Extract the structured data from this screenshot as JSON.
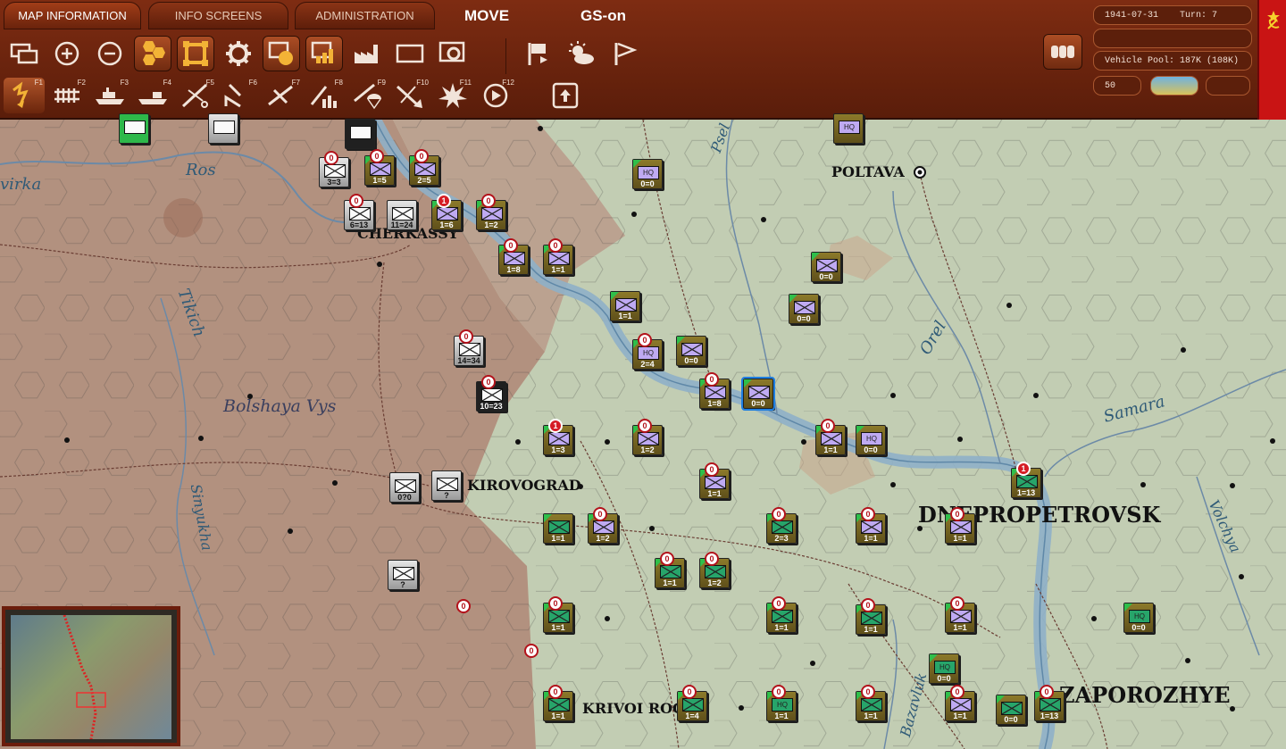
{
  "tabs": [
    {
      "label": "MAP INFORMATION",
      "active": true
    },
    {
      "label": "INFO SCREENS",
      "active": false
    },
    {
      "label": "ADMINISTRATION",
      "active": false
    }
  ],
  "mode": {
    "phase": "MOVE",
    "gs": "GS-on"
  },
  "status": {
    "date": "1941-07-31",
    "turn": "Turn: 7",
    "line2": "",
    "vehicle_pool": "Vehicle Pool: 187K (108K)",
    "zoom": "50"
  },
  "toolbar": {
    "icons": [
      "windows-icon",
      "zoom-in-icon",
      "zoom-out-icon",
      "hex-grid-icon",
      "unit-icon",
      "gear-icon",
      "counter-stack-icon",
      "supply-icon",
      "factory-icon",
      "rectangle-icon",
      "settings-window-icon",
      "flag-exit-icon",
      "weather-icon",
      "pennant-icon",
      "army-icon"
    ]
  },
  "fkeys": [
    {
      "k": "F1",
      "icon": "move-arrow-icon"
    },
    {
      "k": "F2",
      "icon": "rail-icon"
    },
    {
      "k": "F3",
      "icon": "ship-icon"
    },
    {
      "k": "F4",
      "icon": "sea-transport-icon"
    },
    {
      "k": "F5",
      "icon": "air-recon-icon"
    },
    {
      "k": "F6",
      "icon": "airlift-icon"
    },
    {
      "k": "F7",
      "icon": "air-bomb-icon"
    },
    {
      "k": "F8",
      "icon": "city-bomb-icon"
    },
    {
      "k": "F9",
      "icon": "paradrop-icon"
    },
    {
      "k": "F10",
      "icon": "air-transfer-icon"
    },
    {
      "k": "F11",
      "icon": "explosion-icon"
    },
    {
      "k": "F12",
      "icon": "next-unit-icon"
    },
    {
      "k": "",
      "icon": "upload-icon"
    }
  ],
  "cities": [
    {
      "name": "POLTAVA"
    },
    {
      "name": "CHERKASSY"
    },
    {
      "name": "KIROVOGRAD"
    },
    {
      "name": "DNEPROPETROVSK"
    },
    {
      "name": "KRIVOI ROG"
    },
    {
      "name": "ZAPOROZHYE"
    }
  ],
  "rivers": [
    {
      "name": "Ros"
    },
    {
      "name": "Tikich"
    },
    {
      "name": "Psel"
    },
    {
      "name": "Orel"
    },
    {
      "name": "Samara"
    },
    {
      "name": "Volchya"
    },
    {
      "name": "Sinyukha"
    },
    {
      "name": "Bazavluk"
    },
    {
      "name": "virka"
    }
  ],
  "terrain": [
    {
      "name": "Bolshaya Vys"
    }
  ],
  "units": [
    {
      "side": "ger",
      "icon": "w",
      "val": "3=3",
      "badge": "0"
    },
    {
      "side": "sov",
      "icon": "v",
      "val": "1=5",
      "badge": "0"
    },
    {
      "side": "sov",
      "icon": "v",
      "val": "2=5",
      "badge": "0"
    },
    {
      "side": "ger",
      "icon": "w",
      "val": "6=13",
      "badge": "0"
    },
    {
      "side": "ger",
      "icon": "w",
      "val": "11=24",
      "badge": ""
    },
    {
      "side": "sov",
      "icon": "v",
      "val": "1=6",
      "badge": "1"
    },
    {
      "side": "sov",
      "icon": "v",
      "val": "1=2",
      "badge": "0"
    },
    {
      "side": "sov",
      "icon": "v",
      "val": "1=8",
      "badge": "0"
    },
    {
      "side": "sov",
      "icon": "v",
      "val": "1=1",
      "badge": "0"
    },
    {
      "side": "sov",
      "icon": "v",
      "val": "0=0",
      "badge": "",
      "hq": "HQ"
    },
    {
      "side": "sov",
      "icon": "v",
      "val": "1=1",
      "badge": ""
    },
    {
      "side": "sov",
      "icon": "v",
      "val": "0=0",
      "badge": ""
    },
    {
      "side": "sov",
      "icon": "v",
      "val": "0=0",
      "badge": ""
    },
    {
      "side": "ger",
      "icon": "w",
      "val": "14=34",
      "badge": "0"
    },
    {
      "side": "sov",
      "icon": "v",
      "val": "2=4",
      "badge": "0",
      "hq": "HQ"
    },
    {
      "side": "sov",
      "icon": "v",
      "val": "0=0",
      "badge": ""
    },
    {
      "side": "blk",
      "icon": "w",
      "val": "10=23",
      "badge": "0"
    },
    {
      "side": "sov",
      "icon": "v",
      "val": "1=8",
      "badge": "0"
    },
    {
      "side": "sov",
      "icon": "v",
      "val": "0=0",
      "badge": ""
    },
    {
      "side": "sov",
      "icon": "v",
      "val": "1=3",
      "badge": "1"
    },
    {
      "side": "sov",
      "icon": "v",
      "val": "1=2",
      "badge": "0"
    },
    {
      "side": "sov",
      "icon": "v",
      "val": "1=1",
      "badge": "0"
    },
    {
      "side": "sov",
      "icon": "v",
      "val": "0=0",
      "badge": "",
      "hq": "HQ"
    },
    {
      "side": "sov",
      "icon": "v",
      "val": "1=1",
      "badge": "0"
    },
    {
      "side": "ger",
      "icon": "w",
      "val": "0?0",
      "badge": ""
    },
    {
      "side": "ger",
      "icon": "w",
      "val": "?",
      "badge": ""
    },
    {
      "side": "sov",
      "icon": "g",
      "val": "1=13",
      "badge": "1"
    },
    {
      "side": "sov",
      "icon": "g",
      "val": "1=1",
      "badge": ""
    },
    {
      "side": "sov",
      "icon": "v",
      "val": "1=2",
      "badge": "0"
    },
    {
      "side": "sov",
      "icon": "g",
      "val": "2=3",
      "badge": "0"
    },
    {
      "side": "sov",
      "icon": "v",
      "val": "1=1",
      "badge": "0"
    },
    {
      "side": "sov",
      "icon": "v",
      "val": "1=1",
      "badge": "0"
    },
    {
      "side": "sov",
      "icon": "g",
      "val": "1=1",
      "badge": "0"
    },
    {
      "side": "sov",
      "icon": "g",
      "val": "1=2",
      "badge": "0"
    },
    {
      "side": "ger",
      "icon": "w",
      "val": "?",
      "badge": ""
    },
    {
      "side": "sov",
      "icon": "g",
      "val": "1=1",
      "badge": "0"
    },
    {
      "side": "sov",
      "icon": "g",
      "val": "1=1",
      "badge": "0"
    },
    {
      "side": "sov",
      "icon": "g",
      "val": "1=1",
      "badge": "0"
    },
    {
      "side": "sov",
      "icon": "v",
      "val": "1=1",
      "badge": "0"
    },
    {
      "side": "sov",
      "icon": "g",
      "val": "0=0",
      "badge": "",
      "hq": "HQ"
    },
    {
      "side": "sov",
      "icon": "g",
      "val": "0=0",
      "badge": "",
      "hq": "HQ"
    },
    {
      "side": "sov",
      "icon": "g",
      "val": "1=1",
      "badge": "0"
    },
    {
      "side": "sov",
      "icon": "g",
      "val": "1=4",
      "badge": "0"
    },
    {
      "side": "sov",
      "icon": "g",
      "val": "1=1",
      "badge": "0",
      "hq": "HQ"
    },
    {
      "side": "sov",
      "icon": "g",
      "val": "1=1",
      "badge": "0"
    },
    {
      "side": "sov",
      "icon": "v",
      "val": "1=1",
      "badge": "0"
    },
    {
      "side": "sov",
      "icon": "g",
      "val": "0=0",
      "badge": ""
    },
    {
      "side": "sov",
      "icon": "g",
      "val": "1=13",
      "badge": "0"
    }
  ],
  "lone_markers": [
    {
      "val": "0"
    },
    {
      "val": "0"
    }
  ],
  "hq_label": "HQ"
}
